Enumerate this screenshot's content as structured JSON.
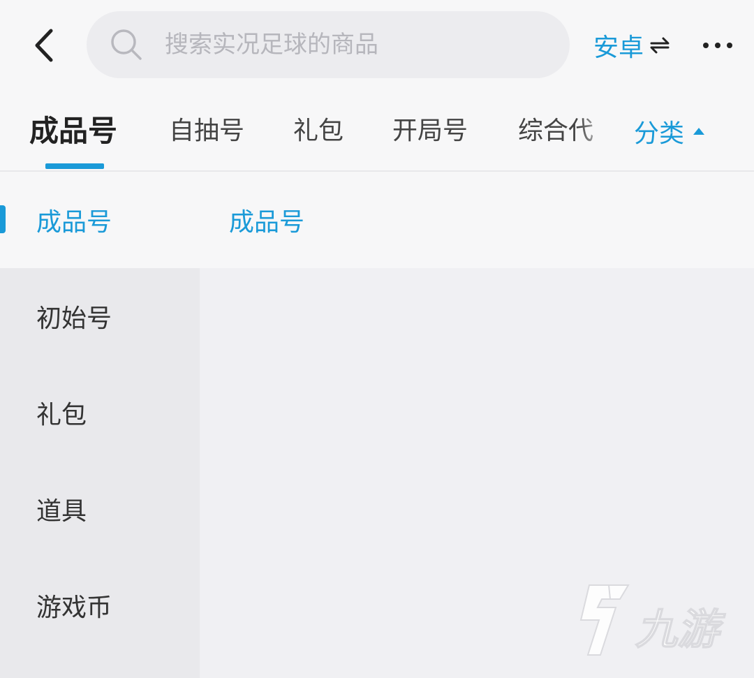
{
  "search": {
    "placeholder": "搜索实况足球的商品",
    "value": ""
  },
  "header": {
    "platform_label": "安卓",
    "icons": {
      "back": "chevron-left-icon",
      "search": "search-icon",
      "platform_switch": "swap-arrows-icon",
      "more": "more-dots-icon"
    }
  },
  "tabs": [
    {
      "label": "成品号",
      "active": true
    },
    {
      "label": "自抽号",
      "active": false
    },
    {
      "label": "礼包",
      "active": false
    },
    {
      "label": "开局号",
      "active": false
    },
    {
      "label": "综合代",
      "active": false
    }
  ],
  "category_toggle": {
    "label": "分类",
    "icon": "caret-up-icon"
  },
  "sidebar": {
    "items": [
      {
        "label": "成品号",
        "active": true
      },
      {
        "label": "初始号",
        "active": false
      },
      {
        "label": "礼包",
        "active": false
      },
      {
        "label": "道具",
        "active": false
      },
      {
        "label": "游戏币",
        "active": false
      }
    ]
  },
  "content": {
    "section_title": "成品号"
  },
  "watermark": {
    "text": "九游"
  },
  "colors": {
    "accent": "#1a9ad8",
    "page_bg": "#f0f0f3",
    "bar_bg": "#f7f7f8",
    "sidebar_bg": "#e9e9ec",
    "text_dark": "#222222",
    "text_muted": "#b6b6bc"
  }
}
